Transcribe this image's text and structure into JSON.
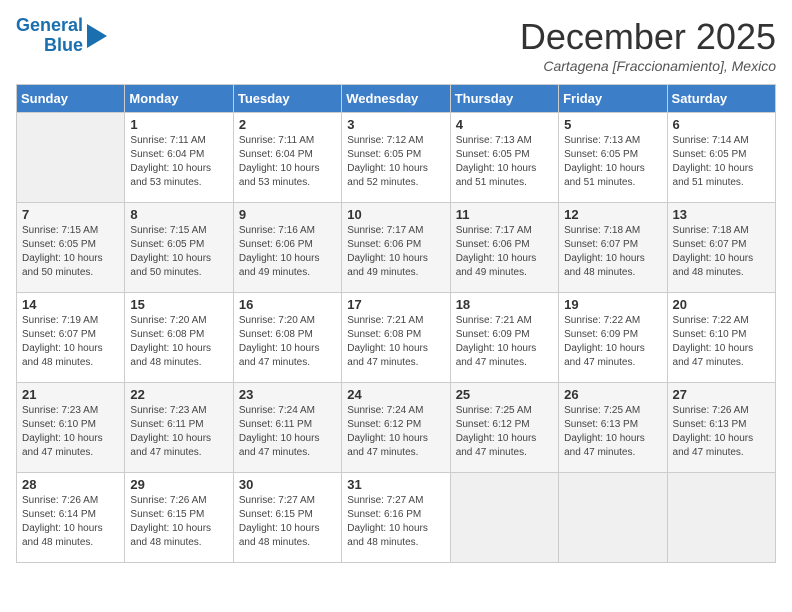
{
  "logo": {
    "line1": "General",
    "line2": "Blue"
  },
  "title": "December 2025",
  "location": "Cartagena [Fraccionamiento], Mexico",
  "days": [
    "Sunday",
    "Monday",
    "Tuesday",
    "Wednesday",
    "Thursday",
    "Friday",
    "Saturday"
  ],
  "weeks": [
    [
      {
        "num": "",
        "info": ""
      },
      {
        "num": "1",
        "info": "Sunrise: 7:11 AM\nSunset: 6:04 PM\nDaylight: 10 hours\nand 53 minutes."
      },
      {
        "num": "2",
        "info": "Sunrise: 7:11 AM\nSunset: 6:04 PM\nDaylight: 10 hours\nand 53 minutes."
      },
      {
        "num": "3",
        "info": "Sunrise: 7:12 AM\nSunset: 6:05 PM\nDaylight: 10 hours\nand 52 minutes."
      },
      {
        "num": "4",
        "info": "Sunrise: 7:13 AM\nSunset: 6:05 PM\nDaylight: 10 hours\nand 51 minutes."
      },
      {
        "num": "5",
        "info": "Sunrise: 7:13 AM\nSunset: 6:05 PM\nDaylight: 10 hours\nand 51 minutes."
      },
      {
        "num": "6",
        "info": "Sunrise: 7:14 AM\nSunset: 6:05 PM\nDaylight: 10 hours\nand 51 minutes."
      }
    ],
    [
      {
        "num": "7",
        "info": "Sunrise: 7:15 AM\nSunset: 6:05 PM\nDaylight: 10 hours\nand 50 minutes."
      },
      {
        "num": "8",
        "info": "Sunrise: 7:15 AM\nSunset: 6:05 PM\nDaylight: 10 hours\nand 50 minutes."
      },
      {
        "num": "9",
        "info": "Sunrise: 7:16 AM\nSunset: 6:06 PM\nDaylight: 10 hours\nand 49 minutes."
      },
      {
        "num": "10",
        "info": "Sunrise: 7:17 AM\nSunset: 6:06 PM\nDaylight: 10 hours\nand 49 minutes."
      },
      {
        "num": "11",
        "info": "Sunrise: 7:17 AM\nSunset: 6:06 PM\nDaylight: 10 hours\nand 49 minutes."
      },
      {
        "num": "12",
        "info": "Sunrise: 7:18 AM\nSunset: 6:07 PM\nDaylight: 10 hours\nand 48 minutes."
      },
      {
        "num": "13",
        "info": "Sunrise: 7:18 AM\nSunset: 6:07 PM\nDaylight: 10 hours\nand 48 minutes."
      }
    ],
    [
      {
        "num": "14",
        "info": "Sunrise: 7:19 AM\nSunset: 6:07 PM\nDaylight: 10 hours\nand 48 minutes."
      },
      {
        "num": "15",
        "info": "Sunrise: 7:20 AM\nSunset: 6:08 PM\nDaylight: 10 hours\nand 48 minutes."
      },
      {
        "num": "16",
        "info": "Sunrise: 7:20 AM\nSunset: 6:08 PM\nDaylight: 10 hours\nand 47 minutes."
      },
      {
        "num": "17",
        "info": "Sunrise: 7:21 AM\nSunset: 6:08 PM\nDaylight: 10 hours\nand 47 minutes."
      },
      {
        "num": "18",
        "info": "Sunrise: 7:21 AM\nSunset: 6:09 PM\nDaylight: 10 hours\nand 47 minutes."
      },
      {
        "num": "19",
        "info": "Sunrise: 7:22 AM\nSunset: 6:09 PM\nDaylight: 10 hours\nand 47 minutes."
      },
      {
        "num": "20",
        "info": "Sunrise: 7:22 AM\nSunset: 6:10 PM\nDaylight: 10 hours\nand 47 minutes."
      }
    ],
    [
      {
        "num": "21",
        "info": "Sunrise: 7:23 AM\nSunset: 6:10 PM\nDaylight: 10 hours\nand 47 minutes."
      },
      {
        "num": "22",
        "info": "Sunrise: 7:23 AM\nSunset: 6:11 PM\nDaylight: 10 hours\nand 47 minutes."
      },
      {
        "num": "23",
        "info": "Sunrise: 7:24 AM\nSunset: 6:11 PM\nDaylight: 10 hours\nand 47 minutes."
      },
      {
        "num": "24",
        "info": "Sunrise: 7:24 AM\nSunset: 6:12 PM\nDaylight: 10 hours\nand 47 minutes."
      },
      {
        "num": "25",
        "info": "Sunrise: 7:25 AM\nSunset: 6:12 PM\nDaylight: 10 hours\nand 47 minutes."
      },
      {
        "num": "26",
        "info": "Sunrise: 7:25 AM\nSunset: 6:13 PM\nDaylight: 10 hours\nand 47 minutes."
      },
      {
        "num": "27",
        "info": "Sunrise: 7:26 AM\nSunset: 6:13 PM\nDaylight: 10 hours\nand 47 minutes."
      }
    ],
    [
      {
        "num": "28",
        "info": "Sunrise: 7:26 AM\nSunset: 6:14 PM\nDaylight: 10 hours\nand 48 minutes."
      },
      {
        "num": "29",
        "info": "Sunrise: 7:26 AM\nSunset: 6:15 PM\nDaylight: 10 hours\nand 48 minutes."
      },
      {
        "num": "30",
        "info": "Sunrise: 7:27 AM\nSunset: 6:15 PM\nDaylight: 10 hours\nand 48 minutes."
      },
      {
        "num": "31",
        "info": "Sunrise: 7:27 AM\nSunset: 6:16 PM\nDaylight: 10 hours\nand 48 minutes."
      },
      {
        "num": "",
        "info": ""
      },
      {
        "num": "",
        "info": ""
      },
      {
        "num": "",
        "info": ""
      }
    ]
  ]
}
